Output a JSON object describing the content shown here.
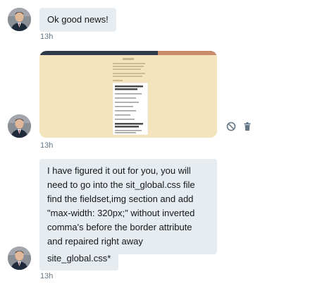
{
  "messages": [
    {
      "text": "Ok good news!",
      "time": "13h"
    },
    {
      "type": "image",
      "time": "13h"
    },
    {
      "text": "I have figured it out for you, you will need to go into the sit_global.css file find the fieldset,img section and add \"max-width: 320px;\" without inverted comma's before the border attribute and repaired right away"
    },
    {
      "text": "site_global.css*",
      "time": "13h"
    }
  ],
  "icons": {
    "block": "block-icon",
    "delete": "trash-icon"
  }
}
